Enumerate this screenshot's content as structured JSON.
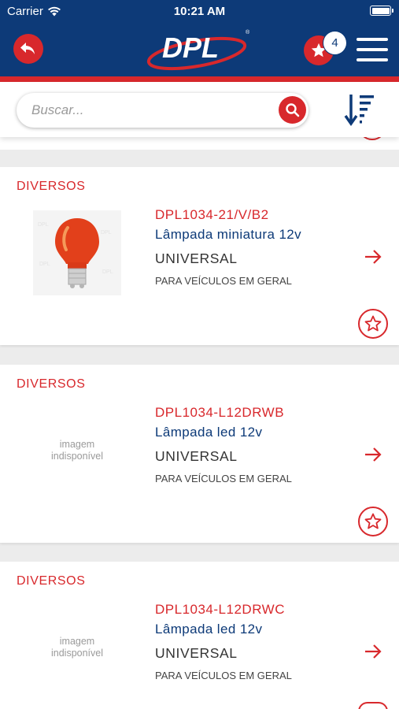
{
  "status_bar": {
    "carrier": "Carrier",
    "time": "10:21 AM"
  },
  "header": {
    "logo_text": "DPL",
    "favorites_count": "4",
    "colors": {
      "brand_blue": "#0d3a78",
      "brand_red": "#d8282c"
    }
  },
  "search": {
    "placeholder": "Buscar...",
    "value": ""
  },
  "products": [
    {
      "category": "DIVERSOS",
      "code": "DPL1034-21/V/B2",
      "name": "Lâmpada miniatura 12v",
      "application": "UNIVERSAL",
      "description": "PARA VEÍCULOS EM GERAL",
      "image": "amber-bulb"
    },
    {
      "category": "DIVERSOS",
      "code": "DPL1034-L12DRWB",
      "name": "Lâmpada led 12v",
      "application": "UNIVERSAL",
      "description": "PARA VEÍCULOS EM GERAL",
      "image_placeholder": "imagem indisponível"
    },
    {
      "category": "DIVERSOS",
      "code": "DPL1034-L12DRWC",
      "name": "Lâmpada led 12v",
      "application": "UNIVERSAL",
      "description": "PARA VEÍCULOS EM GERAL",
      "image_placeholder": "imagem indisponível"
    }
  ]
}
